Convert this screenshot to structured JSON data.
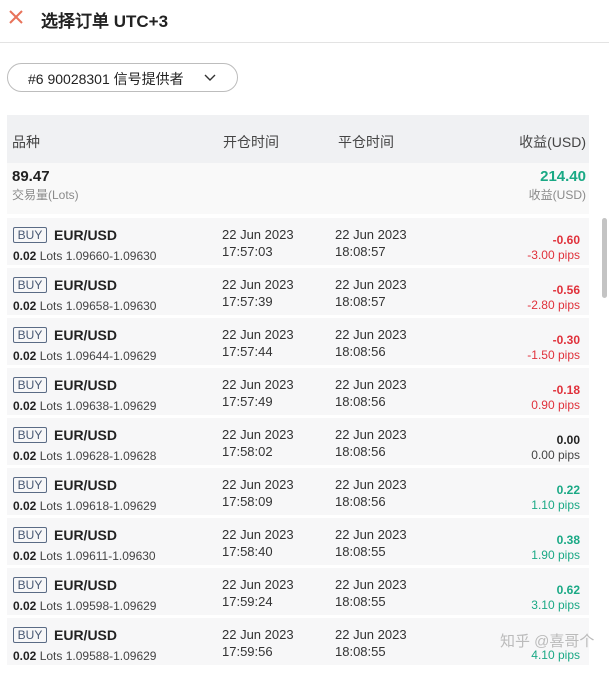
{
  "header": {
    "title": "选择订单 UTC+3"
  },
  "selector": {
    "label": "#6 90028301 信号提供者"
  },
  "columns": {
    "symbol": "品种",
    "open_time": "开仓时间",
    "close_time": "平仓时间",
    "profit": "收益(USD)"
  },
  "summary": {
    "lots": "89.47",
    "lots_label": "交易量(Lots)",
    "profit": "214.40",
    "profit_label": "收益(USD)"
  },
  "rows": [
    {
      "side": "BUY",
      "symbol": "EUR/USD",
      "lots": "0.02",
      "lots_unit": "Lots",
      "prices": "1.09660-1.09630",
      "open_date": "22 Jun 2023",
      "open_time": "17:57:03",
      "close_date": "22 Jun 2023",
      "close_time": "18:08:57",
      "profit": "-0.60",
      "pips": "-3.00 pips",
      "status": "neg"
    },
    {
      "side": "BUY",
      "symbol": "EUR/USD",
      "lots": "0.02",
      "lots_unit": "Lots",
      "prices": "1.09658-1.09630",
      "open_date": "22 Jun 2023",
      "open_time": "17:57:39",
      "close_date": "22 Jun 2023",
      "close_time": "18:08:57",
      "profit": "-0.56",
      "pips": "-2.80 pips",
      "status": "neg"
    },
    {
      "side": "BUY",
      "symbol": "EUR/USD",
      "lots": "0.02",
      "lots_unit": "Lots",
      "prices": "1.09644-1.09629",
      "open_date": "22 Jun 2023",
      "open_time": "17:57:44",
      "close_date": "22 Jun 2023",
      "close_time": "18:08:56",
      "profit": "-0.30",
      "pips": "-1.50 pips",
      "status": "neg"
    },
    {
      "side": "BUY",
      "symbol": "EUR/USD",
      "lots": "0.02",
      "lots_unit": "Lots",
      "prices": "1.09638-1.09629",
      "open_date": "22 Jun 2023",
      "open_time": "17:57:49",
      "close_date": "22 Jun 2023",
      "close_time": "18:08:56",
      "profit": "-0.18",
      "pips": "0.90 pips",
      "status": "neg"
    },
    {
      "side": "BUY",
      "symbol": "EUR/USD",
      "lots": "0.02",
      "lots_unit": "Lots",
      "prices": "1.09628-1.09628",
      "open_date": "22 Jun 2023",
      "open_time": "17:58:02",
      "close_date": "22 Jun 2023",
      "close_time": "18:08:56",
      "profit": "0.00",
      "pips": "0.00 pips",
      "status": "zero"
    },
    {
      "side": "BUY",
      "symbol": "EUR/USD",
      "lots": "0.02",
      "lots_unit": "Lots",
      "prices": "1.09618-1.09629",
      "open_date": "22 Jun 2023",
      "open_time": "17:58:09",
      "close_date": "22 Jun 2023",
      "close_time": "18:08:56",
      "profit": "0.22",
      "pips": "1.10 pips",
      "status": "pos"
    },
    {
      "side": "BUY",
      "symbol": "EUR/USD",
      "lots": "0.02",
      "lots_unit": "Lots",
      "prices": "1.09611-1.09630",
      "open_date": "22 Jun 2023",
      "open_time": "17:58:40",
      "close_date": "22 Jun 2023",
      "close_time": "18:08:55",
      "profit": "0.38",
      "pips": "1.90 pips",
      "status": "pos"
    },
    {
      "side": "BUY",
      "symbol": "EUR/USD",
      "lots": "0.02",
      "lots_unit": "Lots",
      "prices": "1.09598-1.09629",
      "open_date": "22 Jun 2023",
      "open_time": "17:59:24",
      "close_date": "22 Jun 2023",
      "close_time": "18:08:55",
      "profit": "0.62",
      "pips": "3.10 pips",
      "status": "pos"
    },
    {
      "side": "BUY",
      "symbol": "EUR/USD",
      "lots": "0.02",
      "lots_unit": "Lots",
      "prices": "1.09588-1.09629",
      "open_date": "22 Jun 2023",
      "open_time": "17:59:56",
      "close_date": "22 Jun 2023",
      "close_time": "18:08:55",
      "profit": "",
      "pips": "4.10 pips",
      "status": "pos"
    }
  ],
  "watermark": "知乎 @喜哥个",
  "colors": {
    "close_icon": "#e8735a",
    "positive": "#1aa985",
    "negative": "#e0313b"
  },
  "icons": {
    "close": "close-icon",
    "chevron": "chevron-down-icon"
  }
}
